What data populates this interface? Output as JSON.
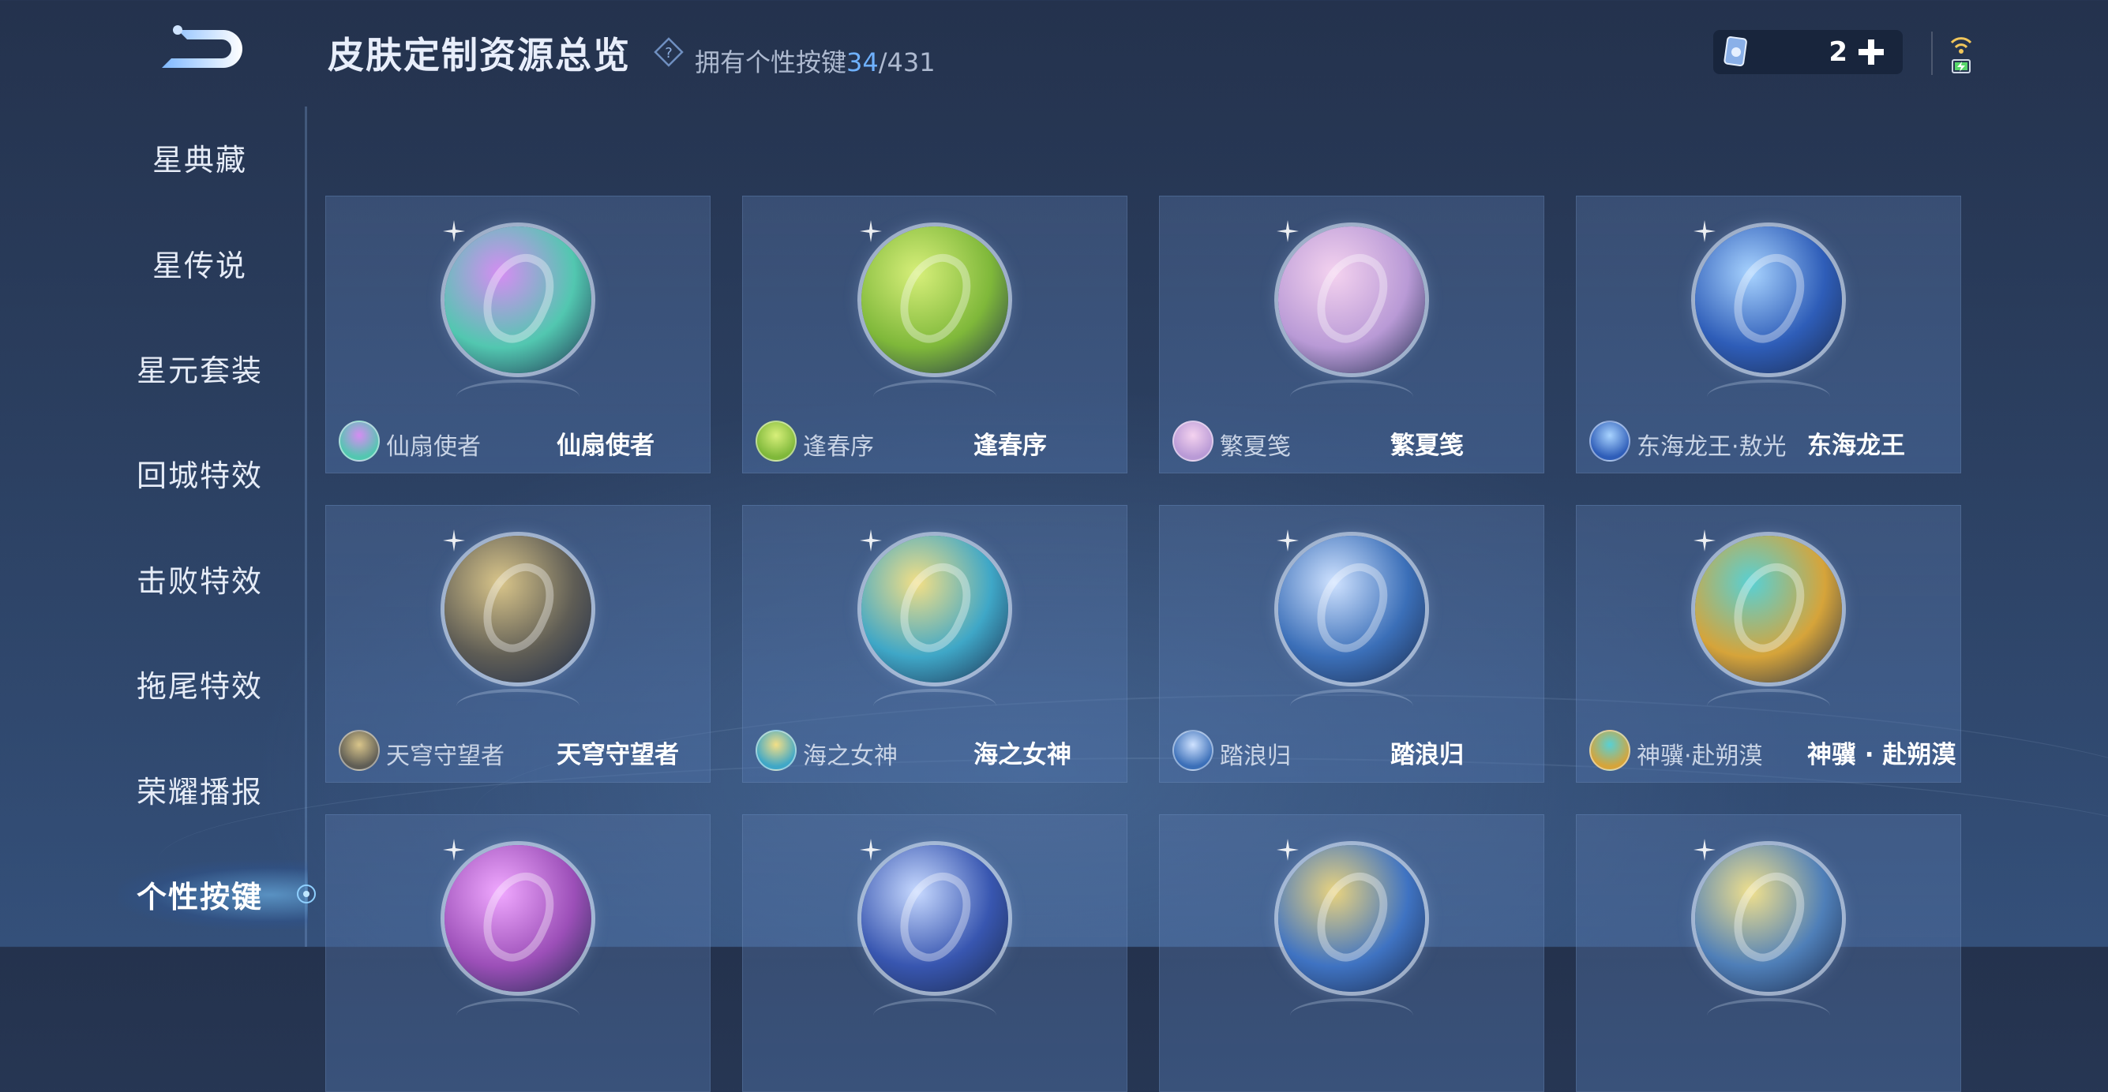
{
  "header": {
    "title": "皮肤定制资源总览",
    "owned_prefix": "拥有个性按键",
    "owned_count": "34",
    "owned_total": "/431"
  },
  "currency": {
    "amount": "2"
  },
  "sidebar": {
    "items": [
      {
        "label": "星典藏"
      },
      {
        "label": "星传说"
      },
      {
        "label": "星元套装"
      },
      {
        "label": "回城特效"
      },
      {
        "label": "击败特效"
      },
      {
        "label": "拖尾特效"
      },
      {
        "label": "荣耀播报"
      },
      {
        "label": "个性按键",
        "active": true
      }
    ]
  },
  "cards": [
    {
      "hero": "仙扇使者",
      "skin": "仙扇使者",
      "orb_color": "#52c7b0",
      "accent": "#d58df2"
    },
    {
      "hero": "逢春序",
      "skin": "逢春序",
      "orb_color": "#7fb83a",
      "accent": "#d7ef7a"
    },
    {
      "hero": "繁夏笺",
      "skin": "繁夏笺",
      "orb_color": "#b99ad6",
      "accent": "#f4d2ef"
    },
    {
      "hero": "东海龙王·敖光",
      "skin": "东海龙王",
      "orb_color": "#2e5db8",
      "accent": "#a8d3ff"
    },
    {
      "hero": "天穹守望者",
      "skin": "天穹守望者",
      "orb_color": "#5f5d55",
      "accent": "#d9c58a"
    },
    {
      "hero": "海之女神",
      "skin": "海之女神",
      "orb_color": "#3fa7c7",
      "accent": "#f3df86"
    },
    {
      "hero": "踏浪归",
      "skin": "踏浪归",
      "orb_color": "#3b6fb8",
      "accent": "#cfe2ff"
    },
    {
      "hero": "神骥·赴朔漠",
      "skin": "神骥 · 赴朔漠",
      "orb_color": "#d6a43a",
      "accent": "#58d0d4"
    },
    {
      "orb_color": "#9c4fb8",
      "accent": "#f0a8ff"
    },
    {
      "orb_color": "#3856b0",
      "accent": "#c7d9ff"
    },
    {
      "orb_color": "#3f73c2",
      "accent": "#e9d37f"
    },
    {
      "orb_color": "#4f7fb8",
      "accent": "#f0e08d"
    }
  ]
}
